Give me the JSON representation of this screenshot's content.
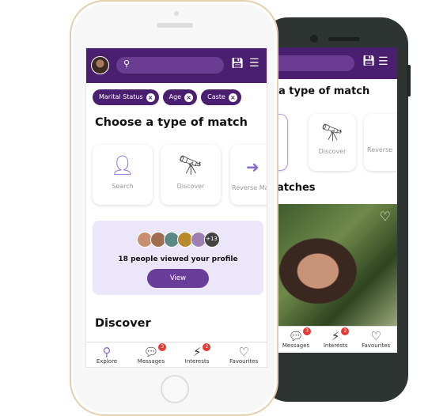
{
  "colors": {
    "primary": "#4b1f6f",
    "accent": "#8c6bd1",
    "badge": "#e53935",
    "banner": "#ece6fb"
  },
  "header": {
    "search_icon": "search-icon",
    "save_icon": "save-icon",
    "filter_icon": "filter-icon"
  },
  "filters": [
    {
      "label": "Marital Status"
    },
    {
      "label": "Age"
    },
    {
      "label": "Caste"
    }
  ],
  "match_heading": "Choose a type of match",
  "match_types": [
    {
      "label": "Search",
      "icon": "person-search-icon"
    },
    {
      "label": "Discover",
      "icon": "telescope-icon"
    },
    {
      "label": "Reverse Match",
      "icon": "arrow-right-icon"
    }
  ],
  "viewers": {
    "more": "+13",
    "text": "18 people viewed your profile",
    "button": "View"
  },
  "discover_heading": "Discover",
  "back": {
    "heading": "a type of match",
    "cards": [
      "Discover",
      "Reverse"
    ],
    "section": "atches"
  },
  "nav": [
    {
      "label": "Explore",
      "icon": "magnifier-icon"
    },
    {
      "label": "Messages",
      "icon": "chat-icon",
      "badge": "3"
    },
    {
      "label": "Interests",
      "icon": "interest-icon",
      "badge": "2"
    },
    {
      "label": "Favourites",
      "icon": "heart-icon"
    }
  ]
}
